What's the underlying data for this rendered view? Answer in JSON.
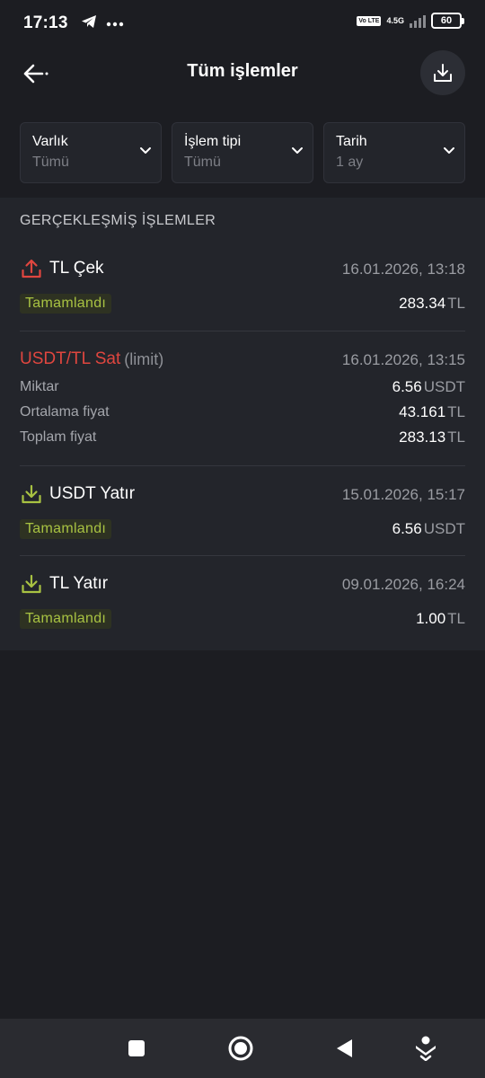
{
  "status_bar": {
    "time": "17:13",
    "volte": "Vo LTE",
    "network": "4.5G",
    "battery": "60",
    "left_icons": [
      "telegram-icon",
      "more-dots-icon"
    ]
  },
  "header": {
    "title": "Tüm işlemler",
    "back_icon": "arrow-left-icon",
    "download_icon": "download-icon"
  },
  "filters": [
    {
      "label": "Varlık",
      "value": "Tümü"
    },
    {
      "label": "İşlem tipi",
      "value": "Tümü"
    },
    {
      "label": "Tarih",
      "value": "1 ay"
    }
  ],
  "section_title": "GERÇEKLEŞMİŞ İŞLEMLER",
  "transactions": [
    {
      "title": "TL Çek",
      "icon": "withdraw-icon",
      "date": "16.01.2026, 13:18",
      "status": "Tamamlandı",
      "amount": "283.34",
      "unit": "TL"
    },
    {
      "title": "USDT/TL Sat",
      "subtitle": "(limit)",
      "date": "16.01.2026, 13:15",
      "details": [
        {
          "label": "Miktar",
          "value": "6.56",
          "unit": "USDT"
        },
        {
          "label": "Ortalama fiyat",
          "value": "43.161",
          "unit": "TL"
        },
        {
          "label": "Toplam fiyat",
          "value": "283.13",
          "unit": "TL"
        }
      ]
    },
    {
      "title": "USDT Yatır",
      "icon": "deposit-icon",
      "date": "15.01.2026, 15:17",
      "status": "Tamamlandı",
      "amount": "6.56",
      "unit": "USDT"
    },
    {
      "title": "TL Yatır",
      "icon": "deposit-icon",
      "date": "09.01.2026, 16:24",
      "status": "Tamamlandı",
      "amount": "1.00",
      "unit": "TL"
    }
  ],
  "colors": {
    "background": "#1c1d22",
    "panel": "#23252b",
    "sell_red": "#e0463f",
    "withdraw_icon": "#e0463f",
    "deposit_icon": "#a8c242",
    "status_green": "#a8c242"
  },
  "nav_bar": [
    "recents-square-icon",
    "home-circle-icon",
    "back-triangle-icon",
    "assistant-icon"
  ]
}
